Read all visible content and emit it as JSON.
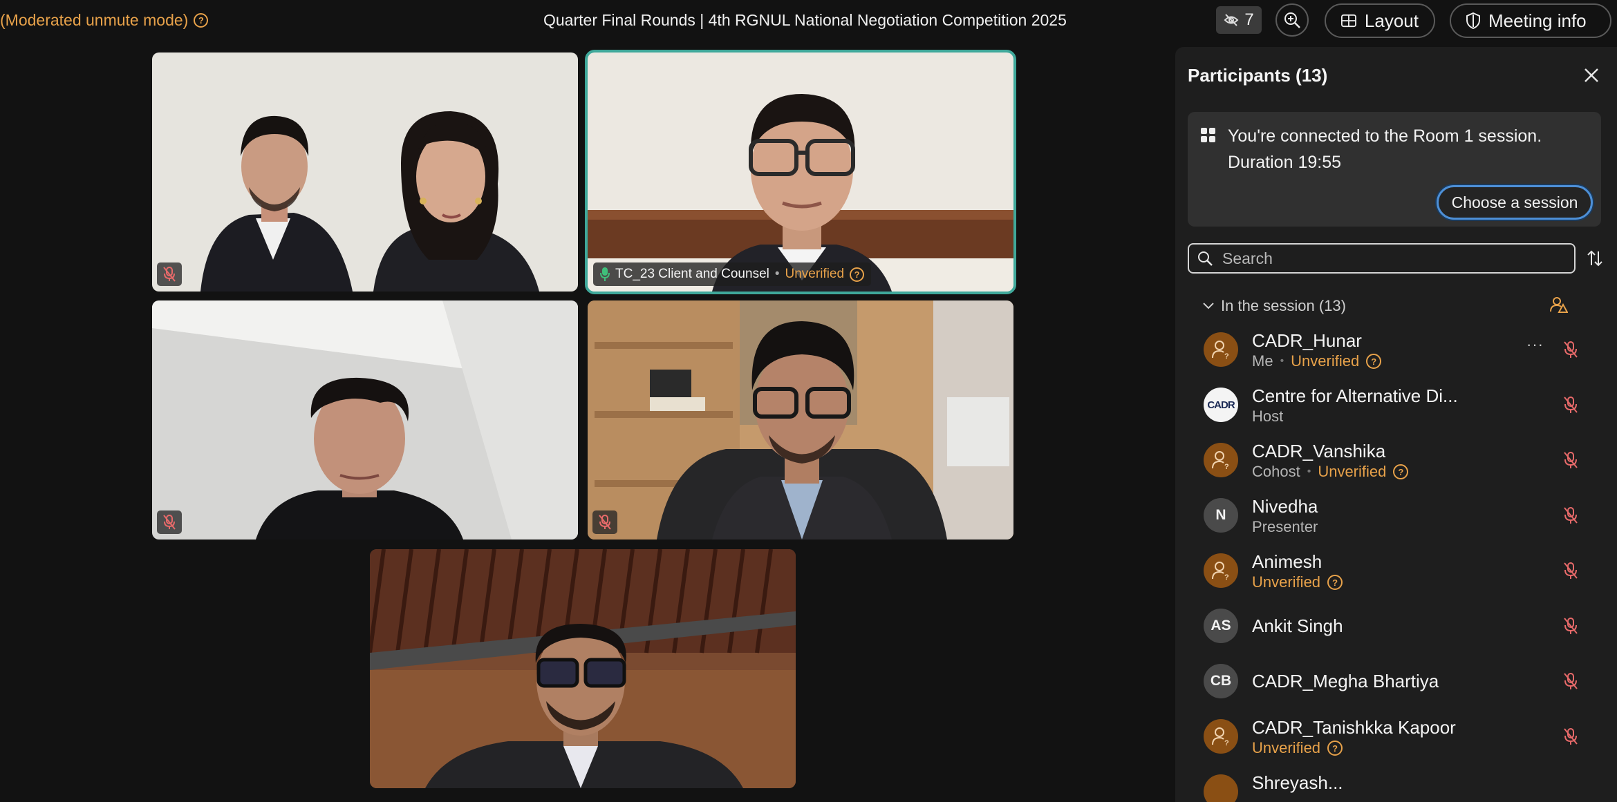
{
  "topbar": {
    "moderated_mode": "(Moderated unmute mode)",
    "meeting_title": "Quarter Final Rounds | 4th RGNUL National Negotiation Competition 2025",
    "hidden_video_count": "7",
    "layout_label": "Layout",
    "meeting_info_label": "Meeting info"
  },
  "video_tiles": [
    {
      "id": "tile-1",
      "mic": "muted",
      "active": false
    },
    {
      "id": "tile-2",
      "mic": "on",
      "active": true,
      "name": "TC_23 Client and Counsel",
      "status": "Unverified"
    },
    {
      "id": "tile-3",
      "mic": "muted",
      "active": false
    },
    {
      "id": "tile-4",
      "mic": "muted",
      "active": false
    },
    {
      "id": "tile-5",
      "mic": "none",
      "active": false
    }
  ],
  "panel": {
    "title": "Participants (13)",
    "session_message_line1": "You're connected to the Room 1 session.",
    "session_message_line2": "Duration 19:55",
    "choose_session_label": "Choose a session",
    "search_placeholder": "Search",
    "section_label": "In the session (13)",
    "participants": [
      {
        "name": "CADR_Hunar",
        "role": "Me",
        "status": "Unverified",
        "avatar": "anonymous-icon",
        "mic": "muted"
      },
      {
        "name": "Centre for Alternative Di...",
        "role": "Host",
        "status": "",
        "avatar": "CADR logo",
        "mic": "muted"
      },
      {
        "name": "CADR_Vanshika",
        "role": "Cohost",
        "status": "Unverified",
        "avatar": "anonymous-icon",
        "mic": "muted"
      },
      {
        "name": "Nivedha",
        "role": "Presenter",
        "status": "",
        "avatar": "N",
        "mic": "muted"
      },
      {
        "name": "Animesh",
        "role": "",
        "status": "Unverified",
        "avatar": "anonymous-icon",
        "mic": "muted"
      },
      {
        "name": "Ankit Singh",
        "role": "",
        "status": "",
        "avatar": "AS",
        "mic": "muted"
      },
      {
        "name": "CADR_Megha Bhartiya",
        "role": "",
        "status": "",
        "avatar": "CB",
        "mic": "muted"
      },
      {
        "name": "CADR_Tanishkka Kapoor",
        "role": "",
        "status": "Unverified",
        "avatar": "anonymous-icon",
        "mic": "muted"
      }
    ],
    "logo_text": "CADR",
    "partial_next_row": "Shreyash..."
  },
  "colors": {
    "accent_orange": "#e8a24a",
    "active_speaker_border": "#3fa89a",
    "focus_blue": "#4d8fd6",
    "mic_off_red": "#e86a6a"
  }
}
